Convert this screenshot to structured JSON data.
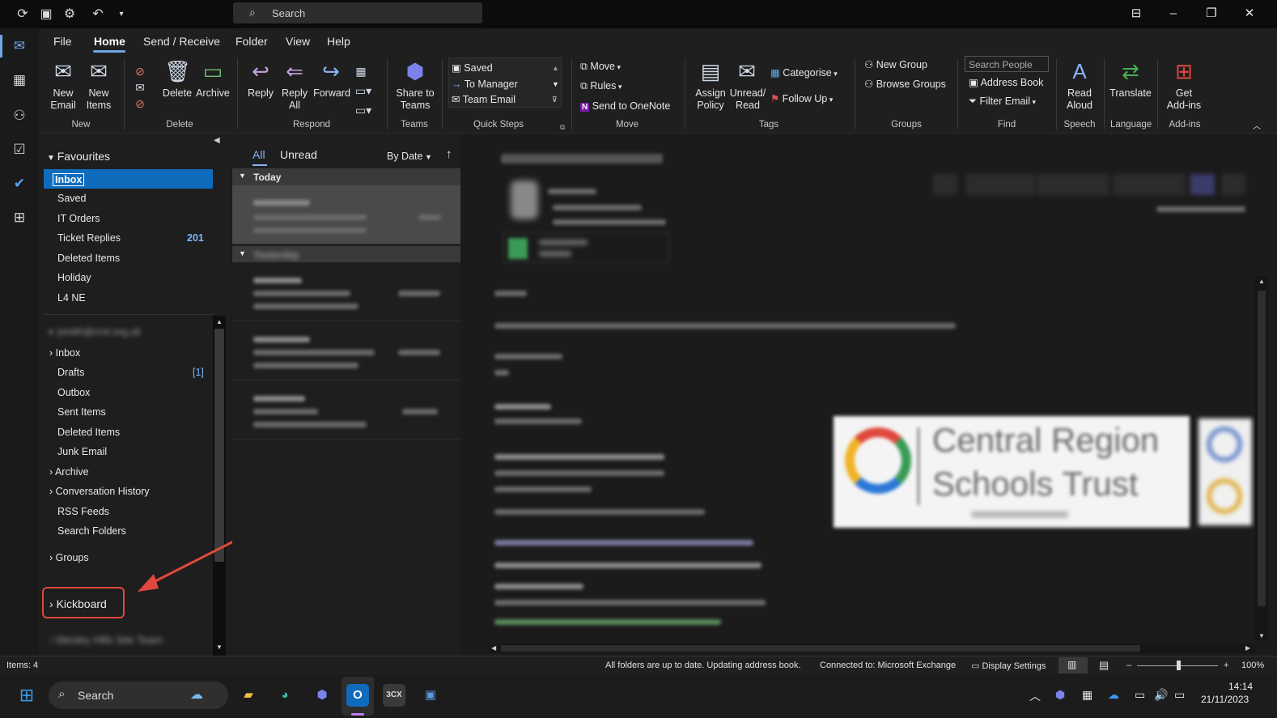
{
  "search": {
    "placeholder": "Search"
  },
  "menu": {
    "file": "File",
    "home": "Home",
    "send_receive": "Send / Receive",
    "folder": "Folder",
    "view": "View",
    "help": "Help"
  },
  "ribbon": {
    "new_email": "New\nEmail",
    "new_items": "New\nItems",
    "delete": "Delete",
    "archive": "Archive",
    "reply": "Reply",
    "reply_all": "Reply\nAll",
    "forward": "Forward",
    "share_to_teams": "Share to\nTeams",
    "qs_saved": "Saved",
    "qs_to_manager": "To Manager",
    "qs_team_email": "Team Email",
    "move": "Move",
    "rules": "Rules",
    "send_to_onenote": "Send to OneNote",
    "assign_policy": "Assign\nPolicy",
    "unread_read": "Unread/\nRead",
    "categorise": "Categorise",
    "follow_up": "Follow Up",
    "new_group": "New Group",
    "browse_groups": "Browse Groups",
    "search_people": "Search People",
    "address_book": "Address Book",
    "filter_email": "Filter Email",
    "read_aloud": "Read\nAloud",
    "translate": "Translate",
    "get_addins": "Get\nAdd-ins",
    "groups": {
      "new": "New",
      "delete": "Delete",
      "respond": "Respond",
      "teams": "Teams",
      "quick_steps": "Quick Steps",
      "move": "Move",
      "tags": "Tags",
      "groups": "Groups",
      "find": "Find",
      "speech": "Speech",
      "language": "Language",
      "addins": "Add-ins"
    }
  },
  "folders": {
    "favourites_header": "Favourites",
    "favourites": [
      {
        "label": "Inbox"
      },
      {
        "label": "Saved"
      },
      {
        "label": "IT Orders"
      },
      {
        "label": "Ticket Replies",
        "count": "201"
      },
      {
        "label": "Deleted Items"
      },
      {
        "label": "Holiday"
      },
      {
        "label": "L4 NE"
      }
    ],
    "account_header": "jsmith@crst.org.uk",
    "account": [
      {
        "label": "Inbox"
      },
      {
        "label": "Drafts",
        "count": "[1]"
      },
      {
        "label": "Outbox"
      },
      {
        "label": "Sent Items"
      },
      {
        "label": "Deleted Items"
      },
      {
        "label": "Junk Email"
      },
      {
        "label": "Archive"
      },
      {
        "label": "Conversation History"
      },
      {
        "label": "RSS Feeds"
      },
      {
        "label": "Search Folders"
      }
    ],
    "groups": "Groups",
    "kickboard": "Kickboard",
    "other_account": "Wesley Hills Site Team"
  },
  "msglist": {
    "tab_all": "All",
    "tab_unread": "Unread",
    "sort": "By Date",
    "today": "Today",
    "yesterday": "Yesterday"
  },
  "reading": {
    "logo_line1": "Central Region",
    "logo_line2": "Schools Trust"
  },
  "status": {
    "items": "Items: 4",
    "sync": "All folders are up to date.  Updating address book.",
    "connection": "Connected to: Microsoft Exchange",
    "display_settings": "Display Settings",
    "zoom": "100%"
  },
  "taskbar": {
    "search": "Search",
    "time": "14:14",
    "date": "21/11/2023"
  },
  "colors": {
    "accent": "#0f6cbd",
    "annotation": "#e0483c",
    "count": "#7cb8f5"
  }
}
